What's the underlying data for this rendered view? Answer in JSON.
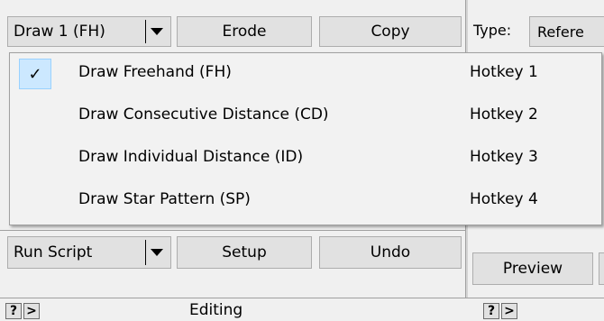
{
  "toolbar": {
    "draw_mode_label": "Draw 1 (FH)",
    "erode_label": "Erode",
    "copy_label": "Copy"
  },
  "type_field": {
    "label": "Type:",
    "value": "Refere"
  },
  "menu": {
    "items": [
      {
        "label": "Draw Freehand (FH)",
        "hotkey": "Hotkey 1",
        "checked": true
      },
      {
        "label": "Draw Consecutive Distance (CD)",
        "hotkey": "Hotkey 2",
        "checked": false
      },
      {
        "label": "Draw Individual Distance (ID)",
        "hotkey": "Hotkey 3",
        "checked": false
      },
      {
        "label": "Draw Star Pattern (SP)",
        "hotkey": "Hotkey 4",
        "checked": false
      }
    ],
    "check_glyph": "✓"
  },
  "actions": {
    "run_script_label": "Run Script",
    "setup_label": "Setup",
    "undo_label": "Undo",
    "preview_label": "Preview"
  },
  "status": {
    "help_glyph": "?",
    "expand_glyph": ">",
    "section_label": "Editing"
  },
  "colors": {
    "menu_highlight": "#cce8ff",
    "button_face": "#e1e1e1"
  }
}
